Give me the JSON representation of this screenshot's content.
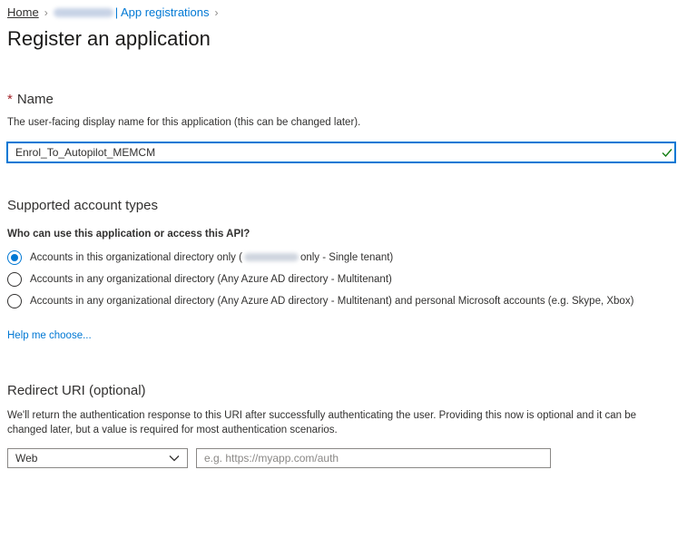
{
  "breadcrumb": {
    "home": "Home",
    "app_registrations": "| App registrations",
    "separator_icon": "chevron-right-icon"
  },
  "page_title": "Register an application",
  "name_section": {
    "required_marker": "*",
    "label": "Name",
    "description": "The user-facing display name for this application (this can be changed later).",
    "value": "Enrol_To_Autopilot_MEMCM",
    "valid_icon": "checkmark-icon"
  },
  "account_types": {
    "heading": "Supported account types",
    "question": "Who can use this application or access this API?",
    "options": [
      {
        "label_before": "Accounts in this organizational directory only (",
        "label_after": "only - Single tenant)",
        "selected": true
      },
      {
        "label": "Accounts in any organizational directory (Any Azure AD directory - Multitenant)",
        "selected": false
      },
      {
        "label": "Accounts in any organizational directory (Any Azure AD directory - Multitenant) and personal Microsoft accounts (e.g. Skype, Xbox)",
        "selected": false
      }
    ],
    "help_link": "Help me choose..."
  },
  "redirect": {
    "heading": "Redirect URI (optional)",
    "description": "We'll return the authentication response to this URI after successfully authenticating the user. Providing this now is optional and it can be changed later, but a value is required for most authentication scenarios.",
    "platform_value": "Web",
    "uri_placeholder": "e.g. https://myapp.com/auth",
    "uri_value": ""
  },
  "colors": {
    "accent": "#0078d4",
    "required": "#a4262c",
    "valid": "#107c10"
  }
}
